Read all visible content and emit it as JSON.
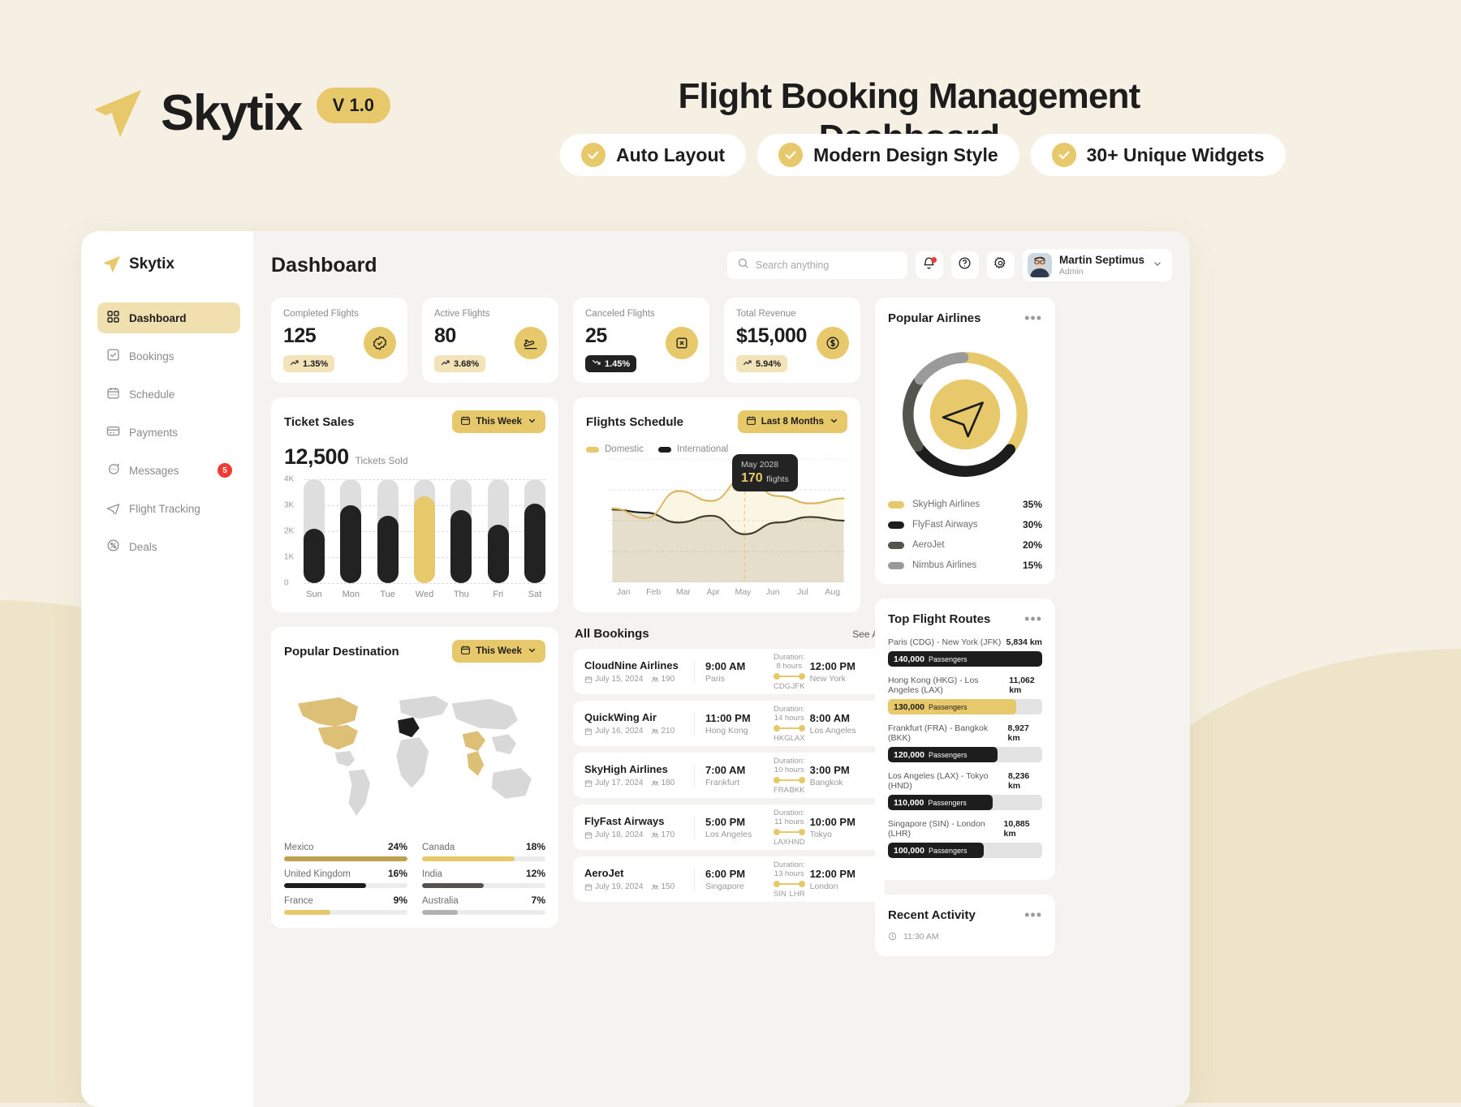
{
  "promo": {
    "brand_name": "Skytix",
    "version": "V 1.0",
    "title": "Flight Booking Management Dashboard",
    "pills": [
      "Auto Layout",
      "Modern Design Style",
      "30+ Unique Widgets"
    ]
  },
  "sidebar": {
    "brand": "Skytix",
    "items": [
      {
        "label": "Dashboard",
        "icon": "grid-icon",
        "active": true
      },
      {
        "label": "Bookings",
        "icon": "check-square-icon",
        "active": false
      },
      {
        "label": "Schedule",
        "icon": "calendar-icon",
        "active": false
      },
      {
        "label": "Payments",
        "icon": "card-icon",
        "active": false
      },
      {
        "label": "Messages",
        "icon": "chat-icon",
        "active": false,
        "badge": "5"
      },
      {
        "label": "Flight Tracking",
        "icon": "plane-icon",
        "active": false
      },
      {
        "label": "Deals",
        "icon": "tag-icon",
        "active": false
      }
    ]
  },
  "topbar": {
    "page_title": "Dashboard",
    "search_placeholder": "Search anything",
    "user_name": "Martin Septimus",
    "user_role": "Admin"
  },
  "kpis": [
    {
      "label": "Completed Flights",
      "value": "125",
      "delta": "1.35%",
      "dir": "up",
      "icon": "badge-check-icon"
    },
    {
      "label": "Active Flights",
      "value": "80",
      "delta": "3.68%",
      "dir": "up",
      "icon": "takeoff-icon"
    },
    {
      "label": "Canceled Flights",
      "value": "25",
      "delta": "1.45%",
      "dir": "down",
      "icon": "cancel-icon"
    },
    {
      "label": "Total Revenue",
      "value": "$15,000",
      "delta": "5.94%",
      "dir": "up",
      "icon": "dollar-icon"
    }
  ],
  "ticket_sales": {
    "title": "Ticket Sales",
    "range_label": "This Week",
    "total": "12,500",
    "total_sub": "Tickets Sold"
  },
  "flights_schedule": {
    "title": "Flights Schedule",
    "range_label": "Last 8 Months",
    "legend": [
      "Domestic",
      "International"
    ],
    "tooltip_date": "May 2028",
    "tooltip_value": "170",
    "tooltip_unit": "flights"
  },
  "popular_destination": {
    "title": "Popular Destination",
    "range_label": "This Week",
    "items": [
      {
        "name": "Mexico",
        "pct": "24%",
        "value": 24,
        "color": "#bfa04e"
      },
      {
        "name": "Canada",
        "pct": "18%",
        "value": 18,
        "color": "#e7c86a"
      },
      {
        "name": "United Kingdom",
        "pct": "16%",
        "value": 16,
        "color": "#1d1d1d"
      },
      {
        "name": "India",
        "pct": "12%",
        "value": 12,
        "color": "#55534e"
      },
      {
        "name": "France",
        "pct": "9%",
        "value": 9,
        "color": "#e7c86a"
      },
      {
        "name": "Australia",
        "pct": "7%",
        "value": 7,
        "color": "#b3b3b3"
      }
    ]
  },
  "bookings": {
    "title": "All Bookings",
    "see_all": "See All",
    "rows": [
      {
        "airline": "CloudNine Airlines",
        "date": "July 15, 2024",
        "pax": "190",
        "dep_time": "9:00 AM",
        "dep_city": "Paris",
        "dep_code": "CDG",
        "duration": "Duration: 8 hours",
        "arr_time": "12:00 PM",
        "arr_city": "New York",
        "arr_code": "JFK"
      },
      {
        "airline": "QuickWing Air",
        "date": "July 16, 2024",
        "pax": "210",
        "dep_time": "11:00 PM",
        "dep_city": "Hong Kong",
        "dep_code": "HKG",
        "duration": "Duration: 14 hours",
        "arr_time": "8:00 AM",
        "arr_city": "Los Angeles",
        "arr_code": "LAX"
      },
      {
        "airline": "SkyHigh Airlines",
        "date": "July 17, 2024",
        "pax": "180",
        "dep_time": "7:00 AM",
        "dep_city": "Frankfurt",
        "dep_code": "FRA",
        "duration": "Duration: 10 hours",
        "arr_time": "3:00 PM",
        "arr_city": "Bangkok",
        "arr_code": "BKK"
      },
      {
        "airline": "FlyFast Airways",
        "date": "July 18, 2024",
        "pax": "170",
        "dep_time": "5:00 PM",
        "dep_city": "Los Angeles",
        "dep_code": "LAX",
        "duration": "Duration: 11 hours",
        "arr_time": "10:00 PM",
        "arr_city": "Tokyo",
        "arr_code": "HND"
      },
      {
        "airline": "AeroJet",
        "date": "July 19, 2024",
        "pax": "150",
        "dep_time": "6:00 PM",
        "dep_city": "Singapore",
        "dep_code": "SIN",
        "duration": "Duration: 13 hours",
        "arr_time": "12:00 PM",
        "arr_city": "London",
        "arr_code": "LHR"
      }
    ]
  },
  "popular_airlines": {
    "title": "Popular Airlines",
    "items": [
      {
        "name": "SkyHigh Airlines",
        "pct": "35%",
        "value": 35,
        "color": "#e7c86a"
      },
      {
        "name": "FlyFast Airways",
        "pct": "30%",
        "value": 30,
        "color": "#1d1d1d"
      },
      {
        "name": "AeroJet",
        "pct": "20%",
        "value": 20,
        "color": "#555550"
      },
      {
        "name": "Nimbus Airlines",
        "pct": "15%",
        "value": 15,
        "color": "#9a9a9a"
      }
    ]
  },
  "top_routes": {
    "title": "Top Flight Routes",
    "pax_label": "Passengers",
    "items": [
      {
        "route": "Paris (CDG) - New York (JFK)",
        "km": "5,834 km",
        "pax": "140,000",
        "value": 100,
        "color": "#1d1d1d",
        "text": "#ffffff"
      },
      {
        "route": "Hong Kong (HKG) - Los Angeles (LAX)",
        "km": "11,062 km",
        "pax": "130,000",
        "value": 83,
        "color": "#e7c86a",
        "text": "#1d1d1d"
      },
      {
        "route": "Frankfurt (FRA) - Bangkok (BKK)",
        "km": "8,927 km",
        "pax": "120,000",
        "value": 71,
        "color": "#1d1d1d",
        "text": "#ffffff"
      },
      {
        "route": "Los Angeles (LAX) - Tokyo (HND)",
        "km": "8,236 km",
        "pax": "110,000",
        "value": 68,
        "color": "#1d1d1d",
        "text": "#ffffff"
      },
      {
        "route": "Singapore (SIN) - London (LHR)",
        "km": "10,885 km",
        "pax": "100,000",
        "value": 62,
        "color": "#1d1d1d",
        "text": "#ffffff"
      }
    ]
  },
  "recent_activity": {
    "title": "Recent Activity",
    "time": "11:30 AM"
  },
  "chart_data": [
    {
      "type": "bar",
      "title": "Ticket Sales",
      "categories": [
        "Sun",
        "Mon",
        "Tue",
        "Wed",
        "Thu",
        "Fri",
        "Sat"
      ],
      "values": [
        2100,
        3000,
        2600,
        3350,
        2800,
        2250,
        3050
      ],
      "highlight_index": 3,
      "ylabel": "",
      "xlabel": "",
      "ylim": [
        0,
        4000
      ],
      "yticks": [
        "0",
        "1K",
        "2K",
        "3K",
        "4K"
      ],
      "grid": true,
      "track_max": 4000
    },
    {
      "type": "area",
      "title": "Flights Schedule",
      "x": [
        "Jan",
        "Feb",
        "Mar",
        "Apr",
        "May",
        "Jun",
        "Jul",
        "Aug"
      ],
      "series": [
        {
          "name": "Domestic",
          "color": "#d9b65c",
          "values": [
            120,
            104,
            148,
            132,
            170,
            140,
            128,
            136
          ]
        },
        {
          "name": "International",
          "color": "#1d1d1d",
          "values": [
            118,
            113,
            97,
            108,
            78,
            97,
            106,
            100
          ]
        }
      ],
      "ylim": [
        0,
        200
      ],
      "yticks": [
        "0",
        "50",
        "100",
        "150",
        "200"
      ],
      "grid": true,
      "legend_position": "top-left",
      "annotation": {
        "x": "May",
        "label": "May 2028",
        "value": 170,
        "unit": "flights"
      }
    },
    {
      "type": "pie",
      "title": "Popular Airlines",
      "labels": [
        "SkyHigh Airlines",
        "FlyFast Airways",
        "AeroJet",
        "Nimbus Airlines"
      ],
      "values": [
        35,
        30,
        20,
        15
      ],
      "colors": [
        "#e7c86a",
        "#1d1d1d",
        "#555550",
        "#9a9a9a"
      ]
    },
    {
      "type": "bar",
      "title": "Popular Destination",
      "categories": [
        "Mexico",
        "Canada",
        "United Kingdom",
        "India",
        "France",
        "Australia"
      ],
      "values": [
        24,
        18,
        16,
        12,
        9,
        7
      ],
      "ylabel": "%",
      "xlabel": "",
      "ylim": [
        0,
        100
      ],
      "grid": false
    },
    {
      "type": "bar",
      "title": "Top Flight Routes",
      "categories": [
        "Paris (CDG) - New York (JFK)",
        "Hong Kong (HKG) - Los Angeles (LAX)",
        "Frankfurt (FRA) - Bangkok (BKK)",
        "Los Angeles (LAX) - Tokyo (HND)",
        "Singapore (SIN) - London (LHR)"
      ],
      "values": [
        140000,
        130000,
        120000,
        110000,
        100000
      ],
      "ylabel": "Passengers",
      "xlabel": "",
      "grid": false
    }
  ]
}
